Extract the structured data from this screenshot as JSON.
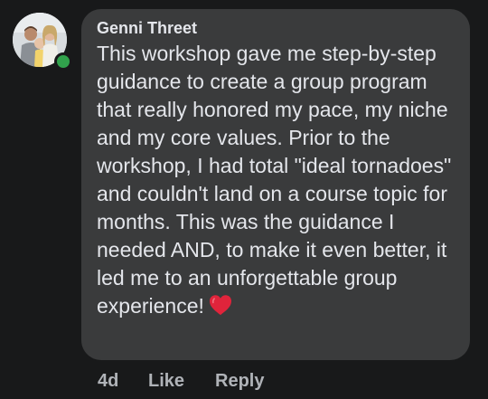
{
  "comment": {
    "author": "Genni Threet",
    "text": "This workshop gave me step-by-step guidance to create a group program that really honored my pace, my niche and my core values. Prior to the workshop, I had total \"ideal tornadoes\" and couldn't land on a course topic for months. This was the guidance I needed AND, to make it even better, it led me to an unforgettable group experience!",
    "reaction_icon": "red-heart-emoji",
    "online_status_color": "#31a24c"
  },
  "actions": {
    "time": "4d",
    "like_label": "Like",
    "reply_label": "Reply"
  }
}
